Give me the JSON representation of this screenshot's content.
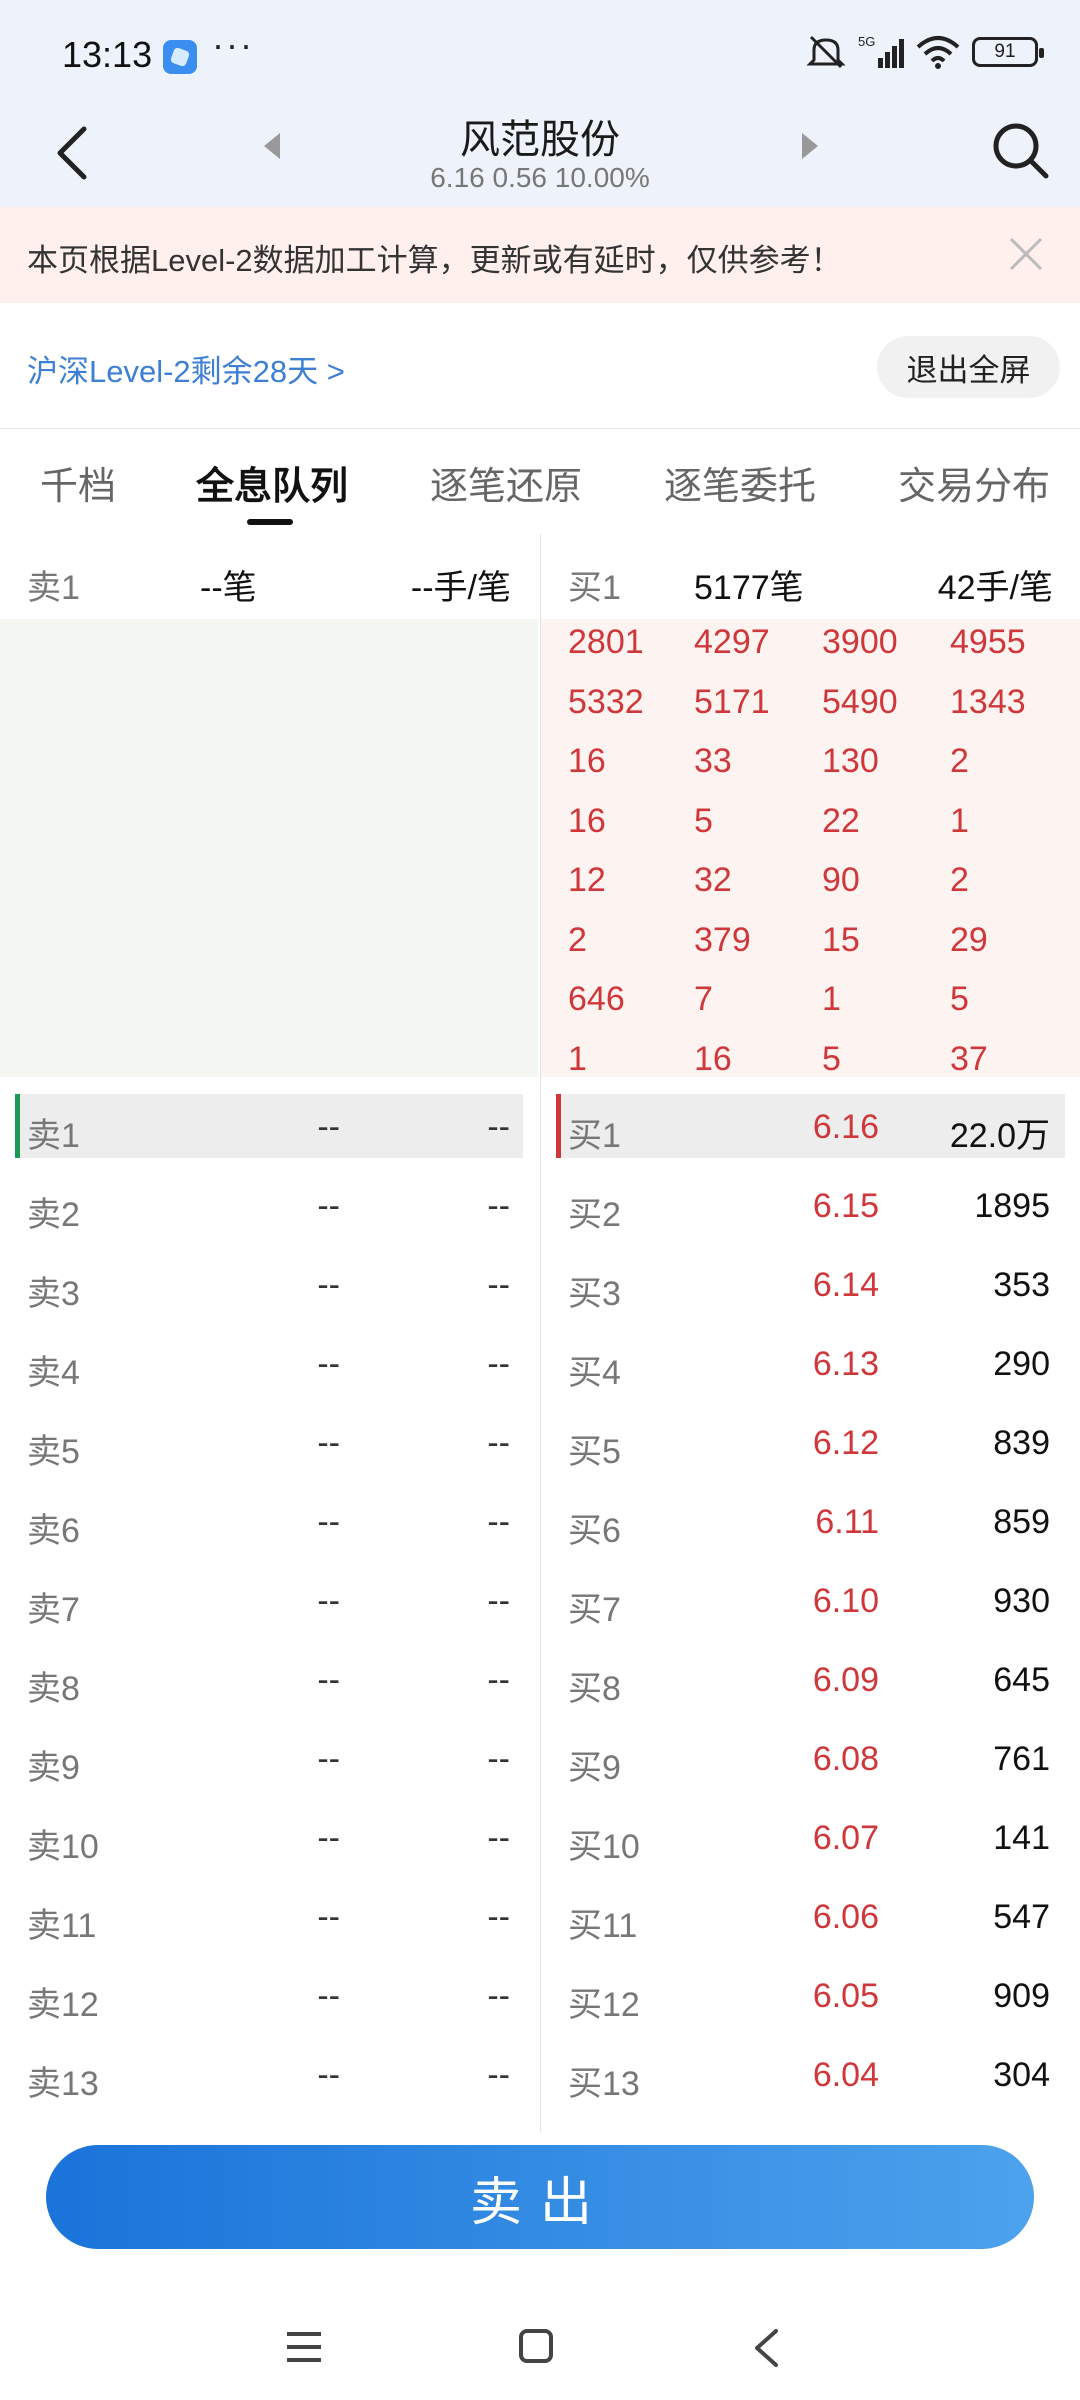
{
  "status_bar": {
    "time": "13:13",
    "more": "···",
    "signal_label": "5G",
    "battery": "91",
    "icons": [
      "app-icon",
      "mute-icon",
      "signal-icon",
      "wifi-icon",
      "battery-icon"
    ]
  },
  "header": {
    "title": "风范股份",
    "quote": "6.16 0.56 10.00%",
    "icons": [
      "back-icon",
      "prev-stock-icon",
      "next-stock-icon",
      "search-icon"
    ]
  },
  "notice": {
    "text": "本页根据Level-2数据加工计算，更新或有延时，仅供参考！",
    "close_icon": "close-icon"
  },
  "level2": {
    "link": "沪深Level-2剩余28天 >",
    "exit_button": "退出全屏"
  },
  "tabs": [
    {
      "label": "千档",
      "active": false
    },
    {
      "label": "全息队列",
      "active": true
    },
    {
      "label": "逐笔还原",
      "active": false
    },
    {
      "label": "逐笔委托",
      "active": false
    },
    {
      "label": "交易分布",
      "active": false
    }
  ],
  "sell_header": {
    "label": "卖1",
    "count": "--笔",
    "per": "--手/笔"
  },
  "buy_header": {
    "label": "买1",
    "count": "5177笔",
    "per": "42手/笔"
  },
  "buy_queue": [
    [
      "2801",
      "4297",
      "3900",
      "4955"
    ],
    [
      "5332",
      "5171",
      "5490",
      "1343"
    ],
    [
      "16",
      "33",
      "130",
      "2"
    ],
    [
      "16",
      "5",
      "22",
      "1"
    ],
    [
      "12",
      "32",
      "90",
      "2"
    ],
    [
      "2",
      "379",
      "15",
      "29"
    ],
    [
      "646",
      "7",
      "1",
      "5"
    ],
    [
      "1",
      "16",
      "5",
      "37"
    ]
  ],
  "sell_orders": [
    {
      "label": "卖1",
      "price": "--",
      "volume": "--"
    },
    {
      "label": "卖2",
      "price": "--",
      "volume": "--"
    },
    {
      "label": "卖3",
      "price": "--",
      "volume": "--"
    },
    {
      "label": "卖4",
      "price": "--",
      "volume": "--"
    },
    {
      "label": "卖5",
      "price": "--",
      "volume": "--"
    },
    {
      "label": "卖6",
      "price": "--",
      "volume": "--"
    },
    {
      "label": "卖7",
      "price": "--",
      "volume": "--"
    },
    {
      "label": "卖8",
      "price": "--",
      "volume": "--"
    },
    {
      "label": "卖9",
      "price": "--",
      "volume": "--"
    },
    {
      "label": "卖10",
      "price": "--",
      "volume": "--"
    },
    {
      "label": "卖11",
      "price": "--",
      "volume": "--"
    },
    {
      "label": "卖12",
      "price": "--",
      "volume": "--"
    },
    {
      "label": "卖13",
      "price": "--",
      "volume": "--"
    }
  ],
  "buy_orders": [
    {
      "label": "买1",
      "price": "6.16",
      "volume": "22.0万"
    },
    {
      "label": "买2",
      "price": "6.15",
      "volume": "1895"
    },
    {
      "label": "买3",
      "price": "6.14",
      "volume": "353"
    },
    {
      "label": "买4",
      "price": "6.13",
      "volume": "290"
    },
    {
      "label": "买5",
      "price": "6.12",
      "volume": "839"
    },
    {
      "label": "买6",
      "price": "6.11",
      "volume": "859"
    },
    {
      "label": "买7",
      "price": "6.10",
      "volume": "930"
    },
    {
      "label": "买8",
      "price": "6.09",
      "volume": "645"
    },
    {
      "label": "买9",
      "price": "6.08",
      "volume": "761"
    },
    {
      "label": "买10",
      "price": "6.07",
      "volume": "141"
    },
    {
      "label": "买11",
      "price": "6.06",
      "volume": "547"
    },
    {
      "label": "买12",
      "price": "6.05",
      "volume": "909"
    },
    {
      "label": "买13",
      "price": "6.04",
      "volume": "304"
    }
  ],
  "sell_button": "卖出",
  "nav_bar": {
    "icons": [
      "menu-icon",
      "home-icon",
      "back-icon"
    ]
  },
  "colors": {
    "up_red": "#d0373a",
    "accent_blue": "#3d7ed6",
    "sell_bar_green": "#1a9a55",
    "buy_bar_red": "#d0373a"
  }
}
